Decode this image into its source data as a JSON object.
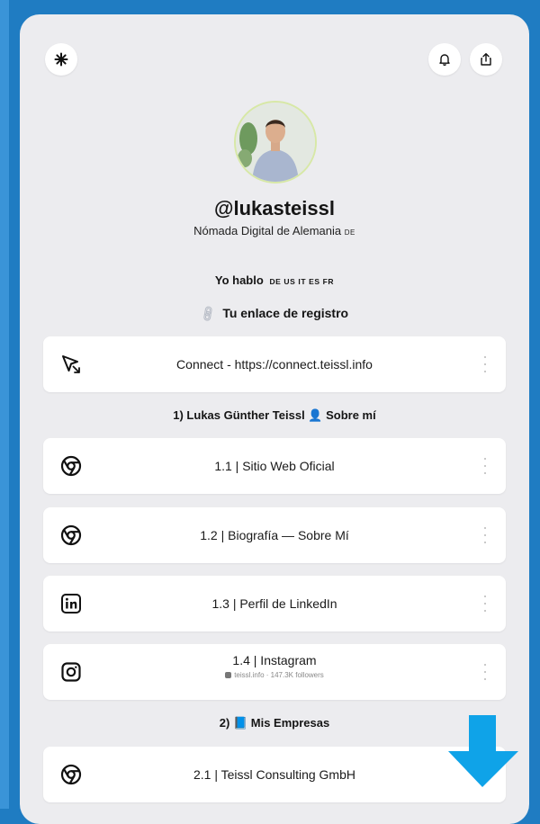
{
  "profile": {
    "username": "@lukasteissl",
    "subtitle": "Nómada Digital de Alemania",
    "subtitle_tag": "DE",
    "languages_label": "Yo hablo",
    "languages_codes": "DE US IT ES FR",
    "signup_link": "Tu enlace de registro"
  },
  "icons": {
    "logo": "sparkle-icon",
    "bell": "bell-icon",
    "share": "share-icon"
  },
  "links": {
    "connect": {
      "label": "Connect - https://connect.teissl.info",
      "icon": "cursor-click-icon"
    },
    "section1": "1) Lukas Günther Teissl 👤 Sobre mí",
    "website": {
      "label": "1.1 | Sitio Web Oficial",
      "icon": "chrome-icon"
    },
    "bio": {
      "label": "1.2 | Biografía — Sobre Mí",
      "icon": "chrome-icon"
    },
    "linkedin": {
      "label": "1.3 | Perfil de LinkedIn",
      "icon": "linkedin-icon"
    },
    "instagram": {
      "label": "1.4 | Instagram",
      "sub": "teissl.info · 147.3K followers",
      "icon": "instagram-icon"
    },
    "section2": "2) 📘 Mis Empresas",
    "consulting": {
      "label": "2.1 | Teissl Consulting GmbH",
      "icon": "chrome-icon"
    }
  },
  "colors": {
    "outer_background": "#1f7cc2",
    "card_background": "#ececef",
    "arrow": "#0fa3e8"
  }
}
